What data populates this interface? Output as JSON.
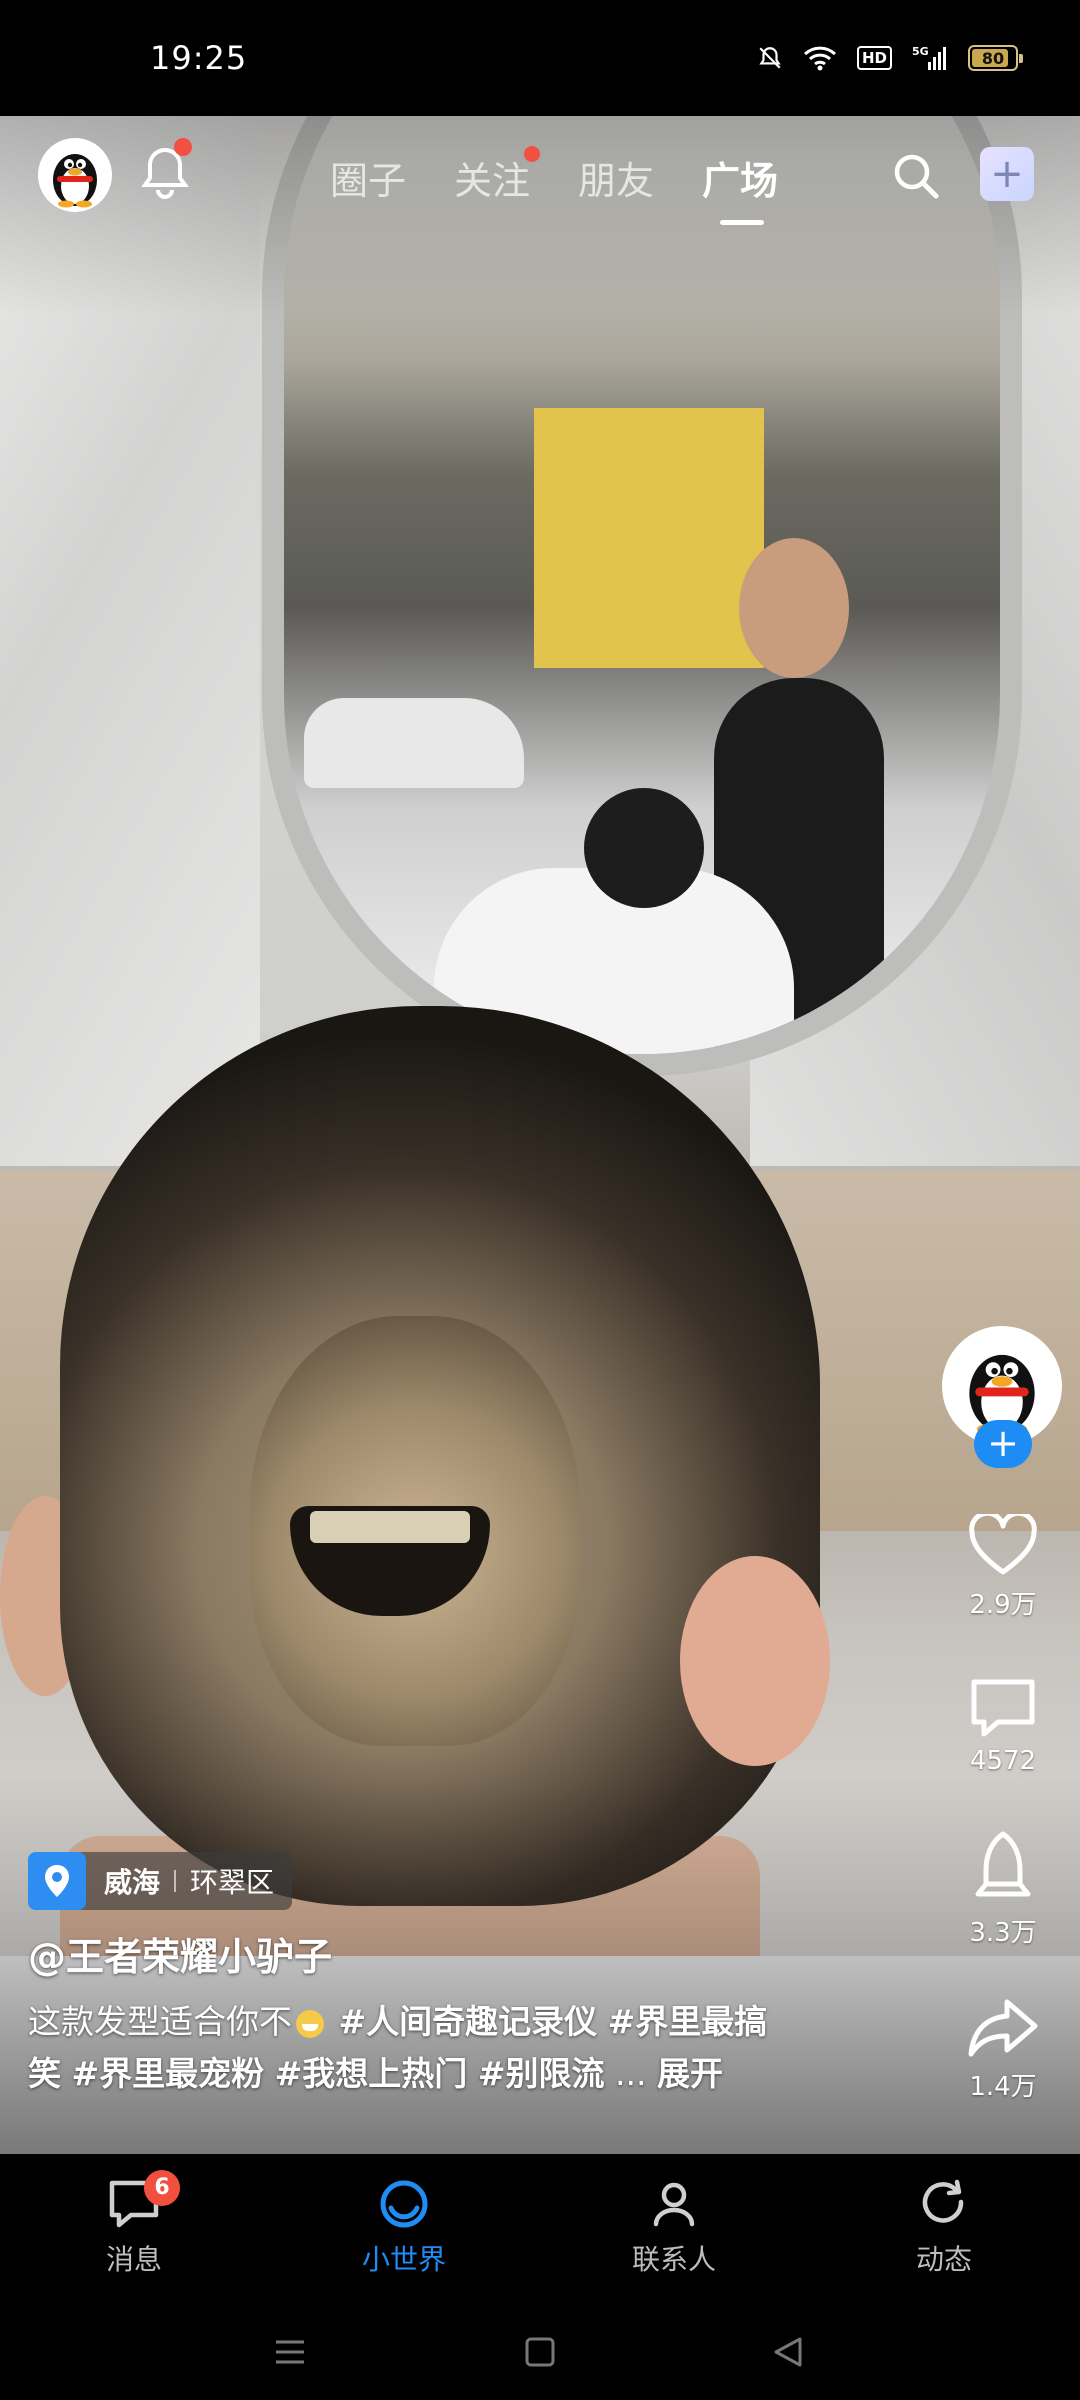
{
  "status_bar": {
    "time": "19:25",
    "hd": "HD",
    "network": "5G",
    "battery": "80"
  },
  "top_nav": {
    "tabs": [
      {
        "label": "圈子",
        "active": false,
        "dot": false
      },
      {
        "label": "关注",
        "active": false,
        "dot": true
      },
      {
        "label": "朋友",
        "active": false,
        "dot": false
      },
      {
        "label": "广场",
        "active": true,
        "dot": false
      }
    ],
    "plus": "+",
    "icons": [
      "qq-penguin-icon",
      "bell-icon",
      "search-icon"
    ]
  },
  "right_rail": {
    "follow": "+",
    "like_count": "2.9万",
    "comment_count": "4572",
    "bell_count": "3.3万",
    "share_count": "1.4万"
  },
  "post": {
    "location": {
      "city": "威海",
      "district": "环翠区"
    },
    "author": "@王者荣耀小驴子",
    "caption_text": "这款发型适合你不",
    "hashtags": [
      "#人间奇趣记录仪",
      "#界里最搞笑",
      "#界里最宠粉",
      "#我想上热门",
      "#别限流"
    ],
    "ellipsis": "...",
    "expand": "展开"
  },
  "bottom_nav": {
    "items": [
      {
        "label": "消息",
        "badge": "6",
        "active": false
      },
      {
        "label": "小世界",
        "active": true
      },
      {
        "label": "联系人",
        "active": false
      },
      {
        "label": "动态",
        "active": false
      }
    ]
  },
  "colors": {
    "accent": "#1f8df5",
    "badge": "#f2503f",
    "follow": "#1e8cf5"
  }
}
